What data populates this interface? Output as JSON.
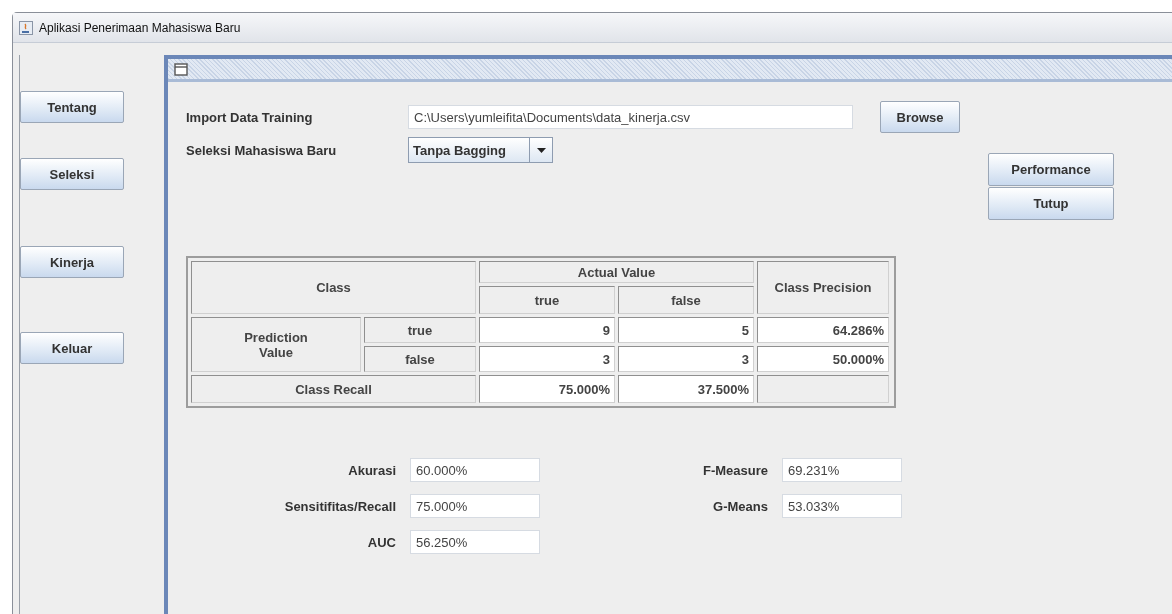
{
  "window": {
    "title": "Aplikasi Penerimaan Mahasiswa Baru"
  },
  "sidebar": {
    "buttons": [
      "Tentang",
      "Seleksi",
      "Kinerja",
      "Keluar"
    ]
  },
  "form": {
    "import_label": "Import Data Training",
    "import_path": "C:\\Users\\yumleifita\\Documents\\data_kinerja.csv",
    "browse_button": "Browse",
    "seleksi_label": "Seleksi Mahasiswa Baru",
    "seleksi_value": "Tanpa Bagging"
  },
  "actions": [
    "Performance",
    "Tutup"
  ],
  "table": {
    "class_header": "Class",
    "actual_header": "Actual Value",
    "actual_columns": [
      "true",
      "false"
    ],
    "precision_header": "Class Precision",
    "group_label": "Prediction Value",
    "rows": [
      {
        "label": "true",
        "values": [
          "9",
          "5"
        ],
        "precision": "64.286%"
      },
      {
        "label": "false",
        "values": [
          "3",
          "3"
        ],
        "precision": "50.000%"
      }
    ],
    "recall": {
      "label": "Class Recall",
      "values": [
        "75.000%",
        "37.500%"
      ]
    }
  },
  "metrics": [
    {
      "label": "Akurasi",
      "value": "60.000%"
    },
    {
      "label": "F-Measure",
      "value": "69.231%"
    },
    {
      "label": "Sensitifitas/Recall",
      "value": "75.000%"
    },
    {
      "label": "G-Means",
      "value": "53.033%"
    },
    {
      "label": "AUC",
      "value": "56.250%"
    }
  ]
}
